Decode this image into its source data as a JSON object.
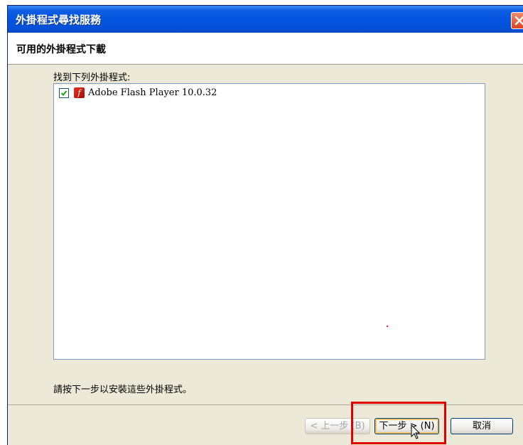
{
  "window": {
    "title": "外掛程式尋找服務",
    "header": "可用的外掛程式下載"
  },
  "content": {
    "list_label": "找到下列外掛程式:",
    "items": [
      {
        "name": "Adobe Flash Player 10.0.32",
        "checked": true,
        "icon": "flash-icon"
      }
    ],
    "instruction": "請按下一步以安裝這些外掛程式。"
  },
  "buttons": {
    "back": "< 上一步 (B)",
    "next": "下一步 > (N)",
    "cancel": "取消"
  },
  "colors": {
    "titlebar": "#0454e0",
    "dialog_bg": "#ece9d8",
    "highlight": "#e00000"
  }
}
